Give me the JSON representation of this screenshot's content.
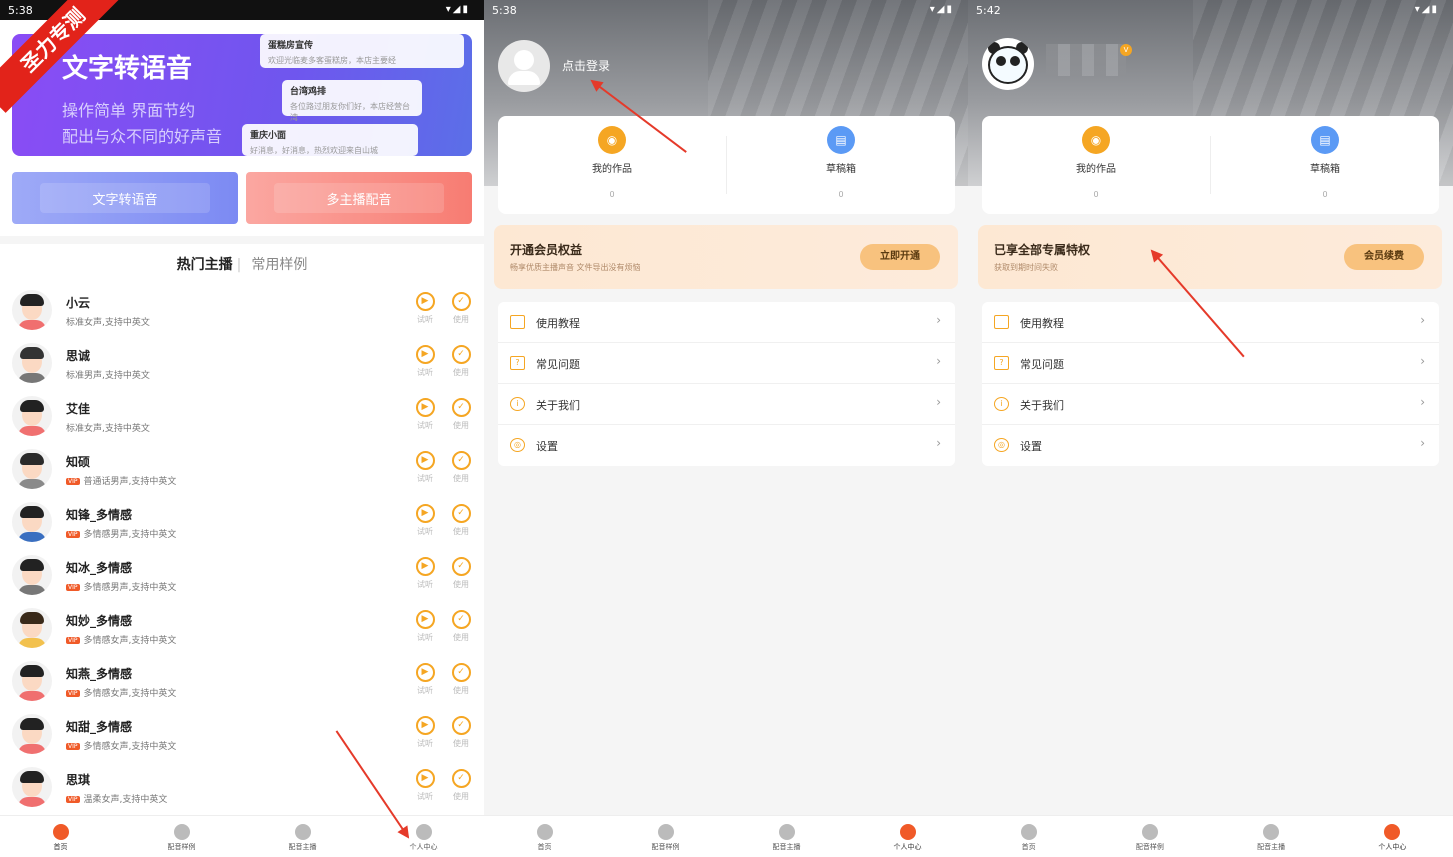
{
  "watermark": "圣力专测",
  "panel1": {
    "time": "5:38",
    "banner": {
      "title": "文字转语音",
      "subtitle1": "操作简单 界面节约",
      "subtitle2": "配出与众不同的好声音",
      "card1_title": "蛋糕房宣传",
      "card1_text": "欢迎光临麦多客蛋糕房，本店主要经",
      "card2_title": "台湾鸡排",
      "card2_text": "各位路过朋友你们好，本店经营台湾",
      "card3_title": "重庆小面",
      "card3_text": "好消息，好消息，热烈欢迎来自山城"
    },
    "btn_tts": "文字转语音",
    "btn_multi": "多主播配音",
    "tab_active": "热门主播",
    "tab_other": "常用样例",
    "action_listen": "试听",
    "action_use": "使用",
    "vip_label": "VIP",
    "voices": [
      {
        "name": "小云",
        "desc": "标准女声,支持中英文",
        "vip": false
      },
      {
        "name": "思诚",
        "desc": "标准男声,支持中英文",
        "vip": false
      },
      {
        "name": "艾佳",
        "desc": "标准女声,支持中英文",
        "vip": false
      },
      {
        "name": "知硕",
        "desc": "普通话男声,支持中英文",
        "vip": true
      },
      {
        "name": "知锋_多情感",
        "desc": "多情感男声,支持中英文",
        "vip": true
      },
      {
        "name": "知冰_多情感",
        "desc": "多情感男声,支持中英文",
        "vip": true
      },
      {
        "name": "知妙_多情感",
        "desc": "多情感女声,支持中英文",
        "vip": true
      },
      {
        "name": "知燕_多情感",
        "desc": "多情感女声,支持中英文",
        "vip": true
      },
      {
        "name": "知甜_多情感",
        "desc": "多情感女声,支持中英文",
        "vip": true
      },
      {
        "name": "思琪",
        "desc": "温柔女声,支持中英文",
        "vip": true
      }
    ]
  },
  "nav": {
    "home": "首页",
    "samples": "配音样例",
    "anchors": "配音主播",
    "profile": "个人中心"
  },
  "panel2": {
    "time": "5:38",
    "login_text": "点击登录",
    "my_works": "我的作品",
    "my_works_count": "0",
    "drafts": "草稿箱",
    "drafts_count": "0",
    "vip_title": "开通会员权益",
    "vip_sub": "畅享优质主播声音 文件导出没有烦恼",
    "vip_button": "立即开通"
  },
  "panel3": {
    "time": "5:42",
    "my_works": "我的作品",
    "my_works_count": "0",
    "drafts": "草稿箱",
    "drafts_count": "0",
    "vip_title": "已享全部专属特权",
    "vip_sub": "获取到期时间失败",
    "vip_button": "会员续费"
  },
  "menu": {
    "tutorial": "使用教程",
    "faq": "常见问题",
    "about": "关于我们",
    "settings": "设置"
  },
  "colors": {
    "accent": "#f5a623",
    "nav_active": "#f05a28",
    "arrow": "#e53a2a"
  }
}
